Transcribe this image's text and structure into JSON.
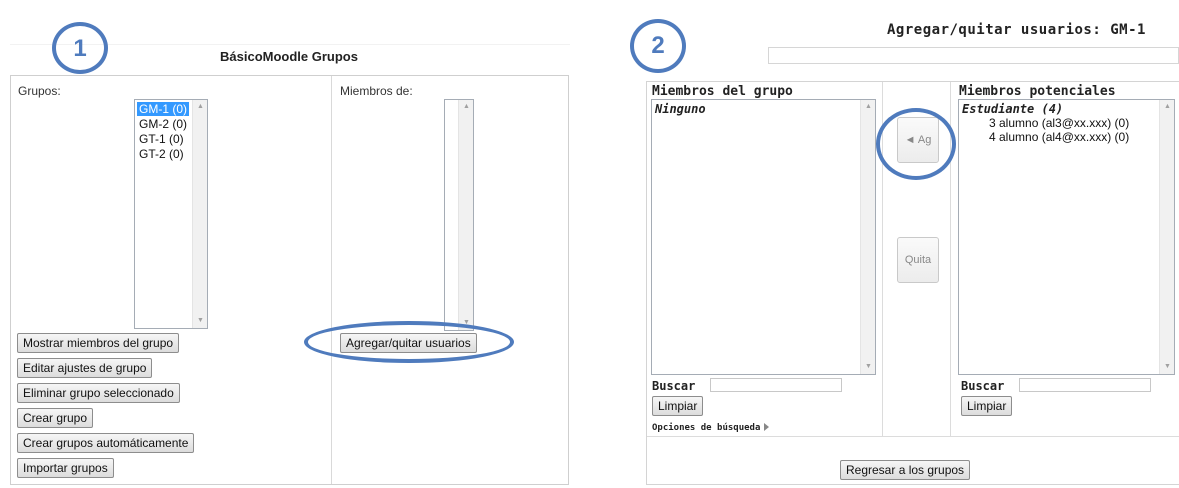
{
  "panel1": {
    "badge": "1",
    "title": "BásicoMoodle Grupos",
    "groups_label": "Grupos:",
    "members_label": "Miembros de:",
    "groups": [
      {
        "label": "GM-1 (0)",
        "selected": true
      },
      {
        "label": "GM-2 (0)",
        "selected": false
      },
      {
        "label": "GT-1 (0)",
        "selected": false
      },
      {
        "label": "GT-2 (0)",
        "selected": false
      }
    ],
    "buttons": {
      "show_members": "Mostrar miembros del grupo",
      "edit_group": "Editar ajustes de grupo",
      "delete_group": "Eliminar grupo seleccionado",
      "create_group": "Crear grupo",
      "auto_create": "Crear grupos automáticamente",
      "import_groups": "Importar grupos",
      "add_remove_users": "Agregar/quitar usuarios"
    }
  },
  "panel2": {
    "badge": "2",
    "title": "Agregar/quitar usuarios: GM-1",
    "group_members_header": "Miembros del grupo",
    "group_members_empty": "Ninguno",
    "potential_header": "Miembros potenciales",
    "potential_group": "Estudiante (4)",
    "potential_users": [
      "3 alumno (al3@xx.xxx) (0)",
      "4 alumno (al4@xx.xxx) (0)"
    ],
    "add_button": "◄ Ag",
    "remove_button": "Quita",
    "search_label": "Buscar",
    "clear_button": "Limpiar",
    "search_options": "Opciones de búsqueda",
    "back_button": "Regresar a los grupos"
  },
  "colors": {
    "annotation": "#4f7bbd",
    "selected": "#3399ff"
  }
}
